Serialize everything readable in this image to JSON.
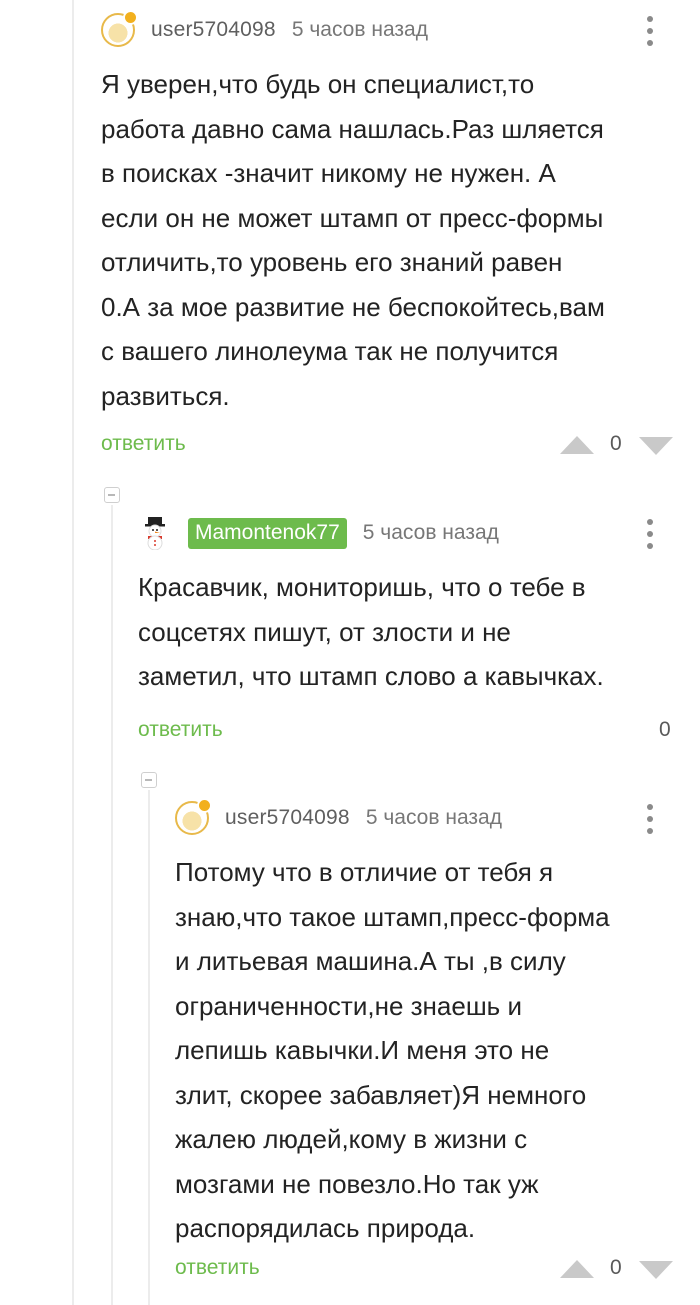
{
  "comments": [
    {
      "username": "user5704098",
      "time": "5 часов назад",
      "text": "Я уверен,что будь он специалист,то\nработа давно сама нашлась.Раз шляется\nв поисках -значит  никому не нужен. А\nесли он не может штамп от пресс-формы\nотличить,то уровень его знаний равен\n0.А за мое развитие не беспокойтесь,вам\nс вашего линолеума так не получится\nразвиться.",
      "reply_label": "ответить",
      "rating": "0"
    },
    {
      "username": "Mamontenok77",
      "time": "5 часов назад",
      "text": "Красавчик, мониторишь, что о тебе в\nсоцсетях пишут, от злости и не\nзаметил, что штамп слово а кавычках.",
      "reply_label": "ответить",
      "rating": "0"
    },
    {
      "username": "user5704098",
      "time": "5 часов назад",
      "text": "Потому что в отличие от тебя я\nзнаю,что такое штамп,пресс-форма\nи литьевая машина.А ты ,в силу\nограниченности,не знаешь и\nлепишь кавычки.И меня это не\nзлит, скорее забавляет)Я немного\nжалею людей,кому в жизни с\nмозгами не повезло.Но так уж\nраспорядилась природа.",
      "reply_label": "ответить",
      "rating": "0"
    }
  ],
  "colors": {
    "accent": "#6dbb4c",
    "badge_text": "#ffffff",
    "muted": "#777777",
    "guide": "#ececec"
  }
}
